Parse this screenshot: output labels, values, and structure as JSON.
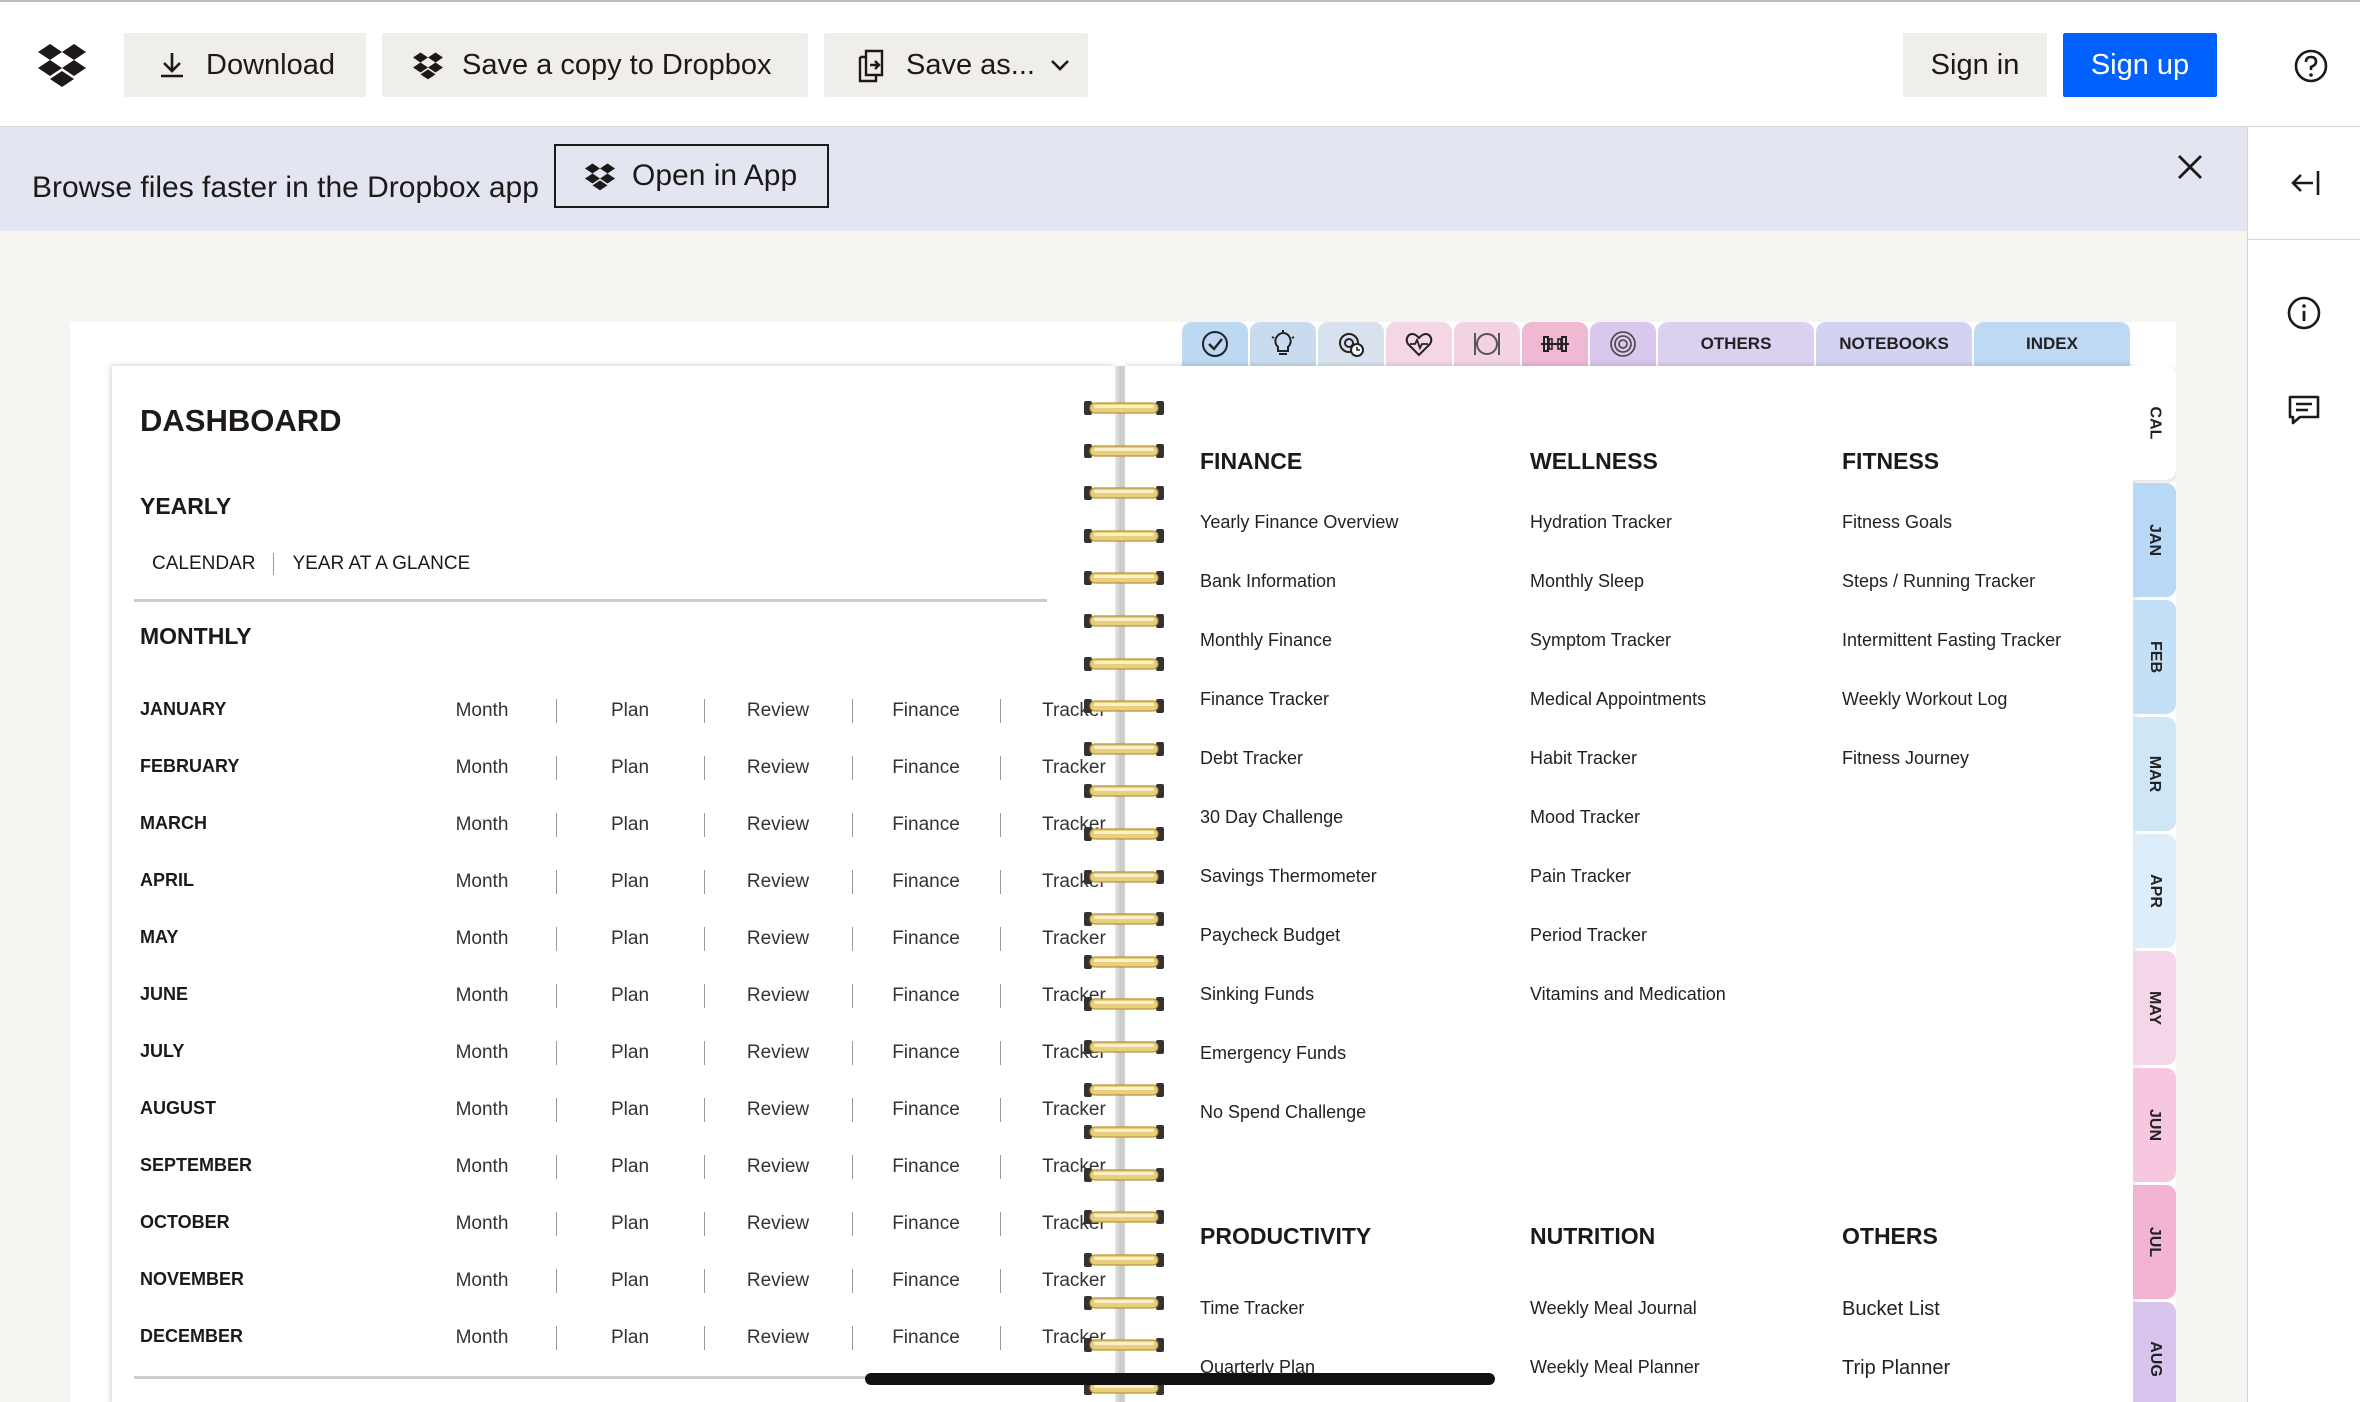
{
  "toolbar": {
    "download": "Download",
    "save_copy": "Save a copy to Dropbox",
    "save_as": "Save as...",
    "sign_in": "Sign in",
    "sign_up": "Sign up"
  },
  "banner": {
    "text": "Browse files faster in the Dropbox app",
    "open_app": "Open in App"
  },
  "colors": {
    "accent": "#0061fe",
    "banner_bg": "#e3e6f1"
  },
  "planner": {
    "top_tabs": [
      {
        "icon": "checkmark-icon",
        "color": "#bcd8f3"
      },
      {
        "icon": "lightbulb-icon",
        "color": "#c9dcef"
      },
      {
        "icon": "gear-clock-icon",
        "color": "#d7e2ee"
      },
      {
        "icon": "heart-pulse-icon",
        "color": "#f5d6e4"
      },
      {
        "icon": "plate-icon",
        "color": "#f3d2e2"
      },
      {
        "icon": "dumbbell-icon",
        "color": "#efb9d4"
      },
      {
        "icon": "target-icon",
        "color": "#d9c7ee"
      },
      {
        "label": "OTHERS",
        "color": "#dcd0f1"
      },
      {
        "label": "NOTEBOOKS",
        "color": "#d4d2f1"
      },
      {
        "label": "INDEX",
        "color": "#bdd9f4"
      }
    ],
    "side_tabs": [
      {
        "label": "CAL",
        "color": "#ffffff"
      },
      {
        "label": "JAN",
        "color": "#b7d9f5"
      },
      {
        "label": "FEB",
        "color": "#c3e0f6"
      },
      {
        "label": "MAR",
        "color": "#cfe6f7"
      },
      {
        "label": "APR",
        "color": "#ddeefa"
      },
      {
        "label": "MAY",
        "color": "#f5d6e8"
      },
      {
        "label": "JUN",
        "color": "#f7c7df"
      },
      {
        "label": "JUL",
        "color": "#f3b3d2"
      },
      {
        "label": "AUG",
        "color": "#d9c4ee"
      }
    ],
    "dashboard_title": "DASHBOARD",
    "yearly_heading": "YEARLY",
    "yearly_links": [
      "CALENDAR",
      "YEAR AT A GLANCE"
    ],
    "monthly_heading": "MONTHLY",
    "month_cols": [
      "Month",
      "Plan",
      "Review",
      "Finance",
      "Tracker"
    ],
    "months": [
      "JANUARY",
      "FEBRUARY",
      "MARCH",
      "APRIL",
      "MAY",
      "JUNE",
      "JULY",
      "AUGUST",
      "SEPTEMBER",
      "OCTOBER",
      "NOVEMBER",
      "DECEMBER"
    ],
    "categories": [
      {
        "heading": "FINANCE",
        "items": [
          "Yearly Finance Overview",
          "Bank Information",
          "Monthly Finance",
          "Finance Tracker",
          "Debt Tracker",
          "30 Day Challenge",
          "Savings Thermometer",
          "Paycheck Budget",
          "Sinking Funds",
          "Emergency Funds",
          "No Spend Challenge"
        ]
      },
      {
        "heading": "WELLNESS",
        "items": [
          "Hydration Tracker",
          "Monthly Sleep",
          "Symptom Tracker",
          "Medical Appointments",
          "Habit Tracker",
          "Mood Tracker",
          "Pain Tracker",
          "Period Tracker",
          "Vitamins and Medication"
        ]
      },
      {
        "heading": "FITNESS",
        "items": [
          "Fitness Goals",
          "Steps / Running Tracker",
          "Intermittent Fasting Tracker",
          "Weekly Workout Log",
          "Fitness Journey"
        ]
      },
      {
        "heading": "PRODUCTIVITY",
        "items": [
          "Time Tracker",
          "Quarterly Plan"
        ]
      },
      {
        "heading": "NUTRITION",
        "items": [
          "Weekly Meal Journal",
          "Weekly Meal Planner"
        ]
      },
      {
        "heading": "OTHERS",
        "items": [
          "Bucket List",
          "Trip Planner"
        ]
      }
    ]
  }
}
